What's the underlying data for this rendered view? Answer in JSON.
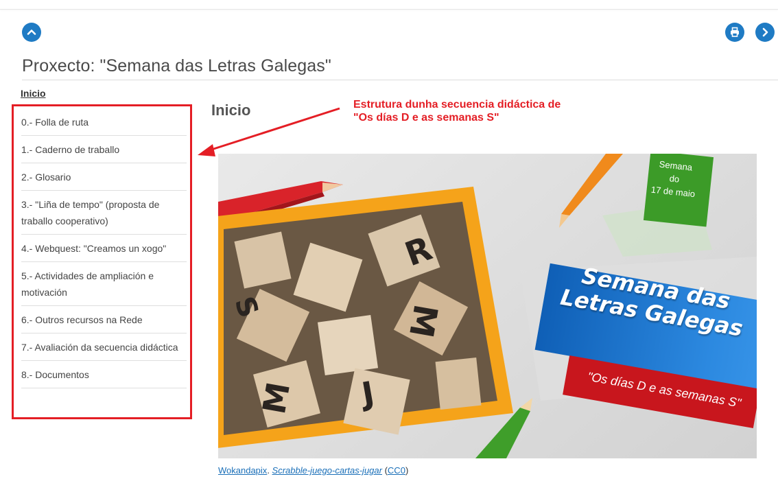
{
  "colors": {
    "accent_blue": "#1f7bc4",
    "annotation_red": "#e41e25",
    "link_blue": "#1a6fb8"
  },
  "toolbar": {
    "up_icon": "chevron-up-icon",
    "print_icon": "print-icon",
    "next_icon": "chevron-right-icon"
  },
  "page": {
    "title": "Proxecto: \"Semana das Letras Galegas\""
  },
  "sidebar": {
    "home_link": "Inicio",
    "items": [
      {
        "label": "0.- Folla de ruta"
      },
      {
        "label": "1.- Caderno de traballo"
      },
      {
        "label": "2.- Glosario"
      },
      {
        "label": "3.- \"Liña de tempo\" (proposta de traballo cooperativo)"
      },
      {
        "label": "4.- Webquest: \"Creamos un xogo\""
      },
      {
        "label": "5.- Actividades de ampliación e motivación"
      },
      {
        "label": "6.- Outros recursos na Rede"
      },
      {
        "label": "7.- Avaliación da secuencia didáctica"
      },
      {
        "label": "8.- Documentos"
      }
    ]
  },
  "annotation": {
    "line1": "Estrutura dunha secuencia didáctica de",
    "line2": "\"Os días D e as semanas S\""
  },
  "main": {
    "section_title": "Inicio",
    "hero": {
      "green_line1": "Semana",
      "green_line2": "do",
      "green_line3": "17 de maio",
      "banner_line1": "Semana das",
      "banner_line2": "Letras Galegas",
      "red_banner": "\"Os días D e as semanas S\""
    },
    "credit": {
      "author": "Wokandapix",
      "sep1": ". ",
      "work": "Scrabble-juego-cartas-jugar",
      "open": " (",
      "license": "CC0",
      "close": ")"
    }
  }
}
